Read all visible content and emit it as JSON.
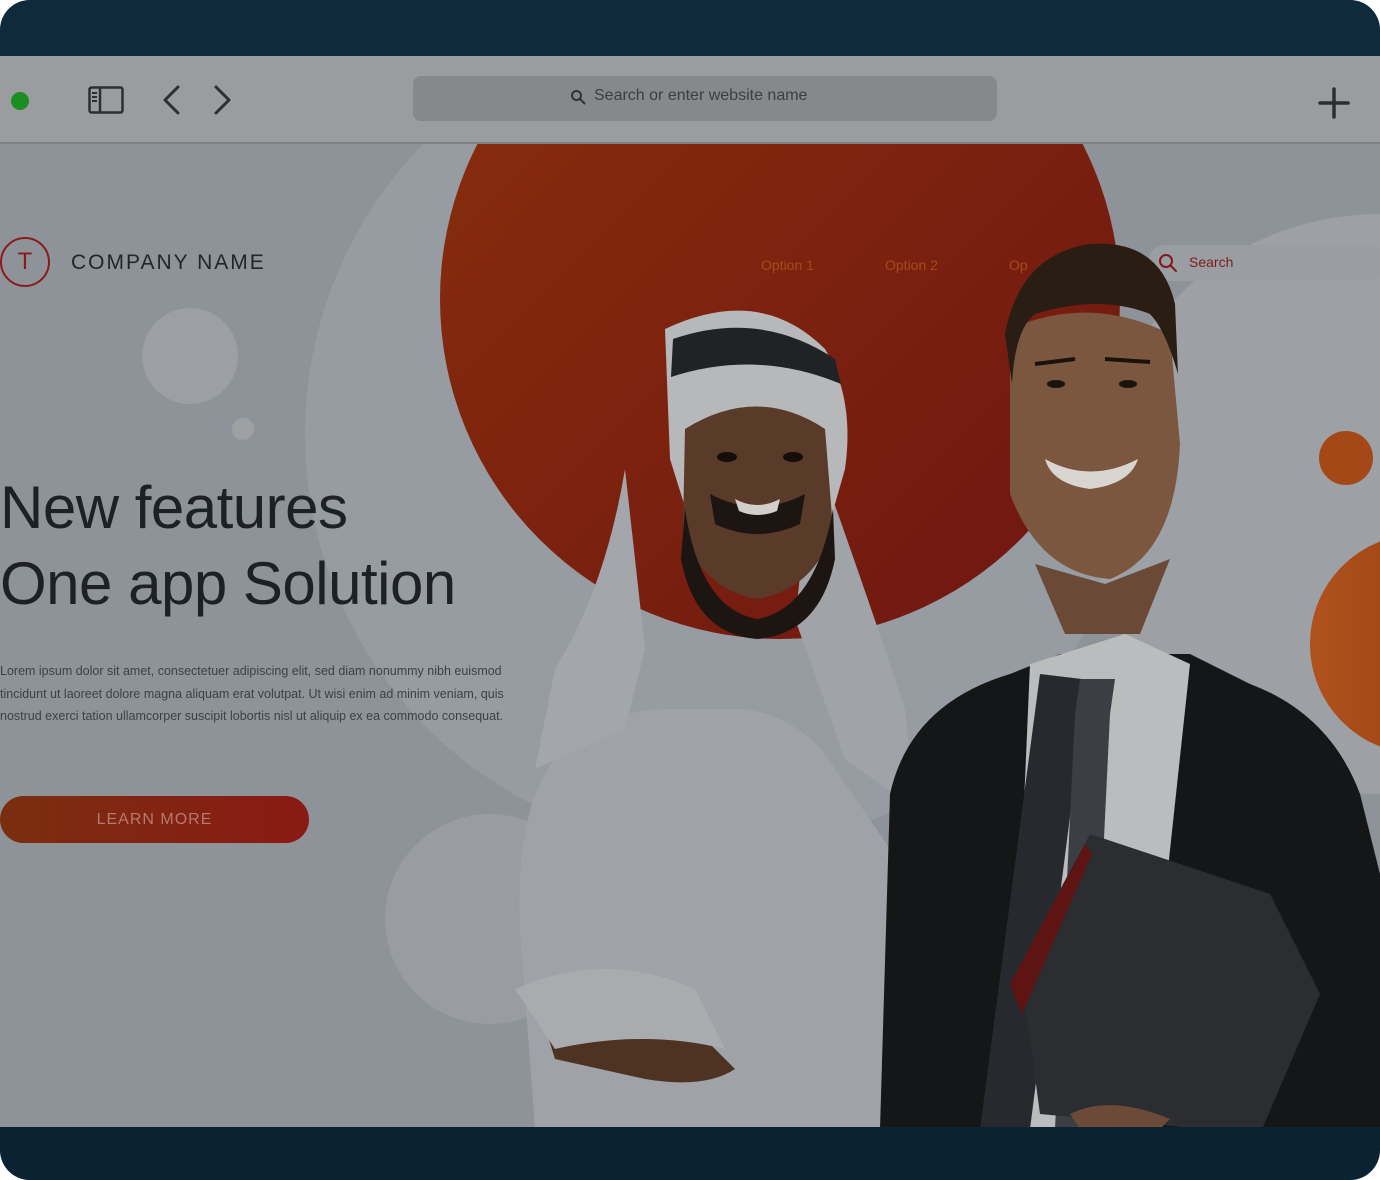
{
  "browser": {
    "address_placeholder": "Search or enter website name",
    "icons": [
      "window-control-green",
      "sidebar-icon",
      "back-icon",
      "forward-icon",
      "search-icon",
      "plus-icon"
    ]
  },
  "site": {
    "logo_letter": "T",
    "company_name": "COMPANY NAME",
    "nav": [
      "Option 1",
      "Option 2",
      "Op"
    ],
    "search_placeholder": "Search",
    "hero_line1": "New features",
    "hero_line2": "One app Solution",
    "body_text": "Lorem ipsum dolor sit amet, consectetuer adipiscing elit, sed diam nonummy nibh euismod tincidunt ut laoreet dolore magna aliquam erat volutpat. Ut wisi enim ad minim veniam, quis nostrud exerci tation ullamcorper suscipit lobortis nisl ut aliquip ex ea commodo consequat.",
    "cta_label": "LEARN MORE"
  },
  "colors": {
    "brand_orange": "#d8461a",
    "brand_red": "#c0241e",
    "window_control": "#1b8e22"
  }
}
